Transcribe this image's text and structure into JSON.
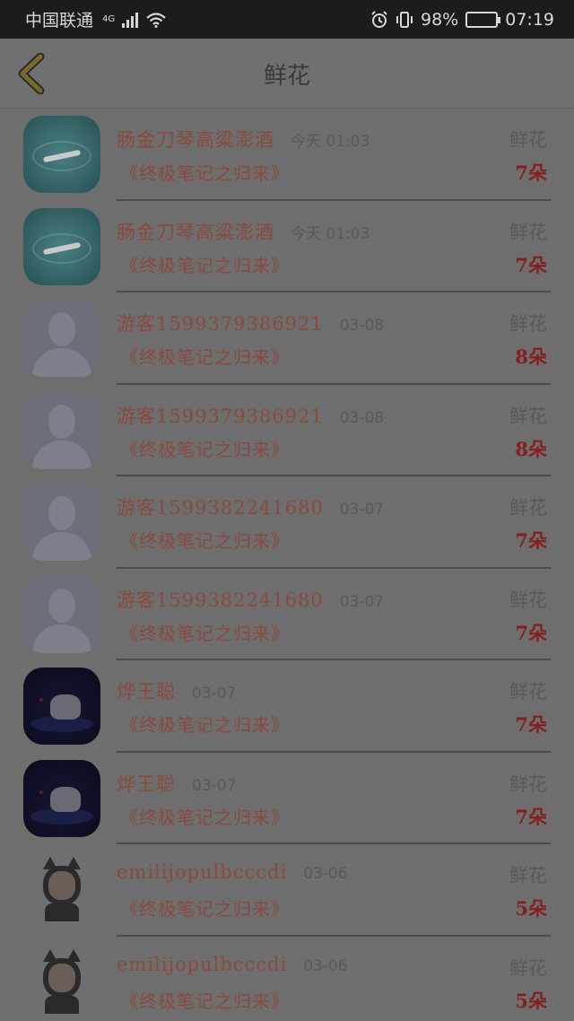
{
  "status_bar": {
    "carrier": "中国联通",
    "network": "4G",
    "battery": "98%",
    "time": "07:19"
  },
  "header": {
    "title": "鲜花"
  },
  "rows": [
    {
      "name": "肠金刀琴高粱澎酒",
      "time": "今天 01:03",
      "gift": "鲜花",
      "book": "《终极笔记之归来》",
      "count": "7朵",
      "avatar": "water-swimmer"
    },
    {
      "name": "肠金刀琴高粱澎酒",
      "time": "今天 01:03",
      "gift": "鲜花",
      "book": "《终极笔记之归来》",
      "count": "7朵",
      "avatar": "water-swimmer"
    },
    {
      "name": "游客15993793869​21",
      "time": "03-08",
      "gift": "鲜花",
      "book": "《终极笔记之归来》",
      "count": "8朵",
      "avatar": "default-user"
    },
    {
      "name": "游客15993793869​21",
      "time": "03-08",
      "gift": "鲜花",
      "book": "《终极笔记之归来》",
      "count": "8朵",
      "avatar": "default-user"
    },
    {
      "name": "游客1599382241680",
      "time": "03-07",
      "gift": "鲜花",
      "book": "《终极笔记之归来》",
      "count": "7朵",
      "avatar": "default-user"
    },
    {
      "name": "游客1599382241680",
      "time": "03-07",
      "gift": "鲜花",
      "book": "《终极笔记之归来》",
      "count": "7朵",
      "avatar": "default-user"
    },
    {
      "name": "烨王聪",
      "time": "03-07",
      "gift": "鲜花",
      "book": "《终极笔记之归来》",
      "count": "7朵",
      "avatar": "night-scene"
    },
    {
      "name": "烨王聪",
      "time": "03-07",
      "gift": "鲜花",
      "book": "《终极笔记之归来》",
      "count": "7朵",
      "avatar": "night-scene"
    },
    {
      "name": "emilijopulbcccdi",
      "time": "03-06",
      "gift": "鲜花",
      "book": "《终极笔记之归来》",
      "count": "5朵",
      "avatar": "cat-character"
    },
    {
      "name": "emilijopulbcccdi",
      "time": "03-06",
      "gift": "鲜花",
      "book": "《终极笔记之归来》",
      "count": "5朵",
      "avatar": "cat-character"
    }
  ]
}
